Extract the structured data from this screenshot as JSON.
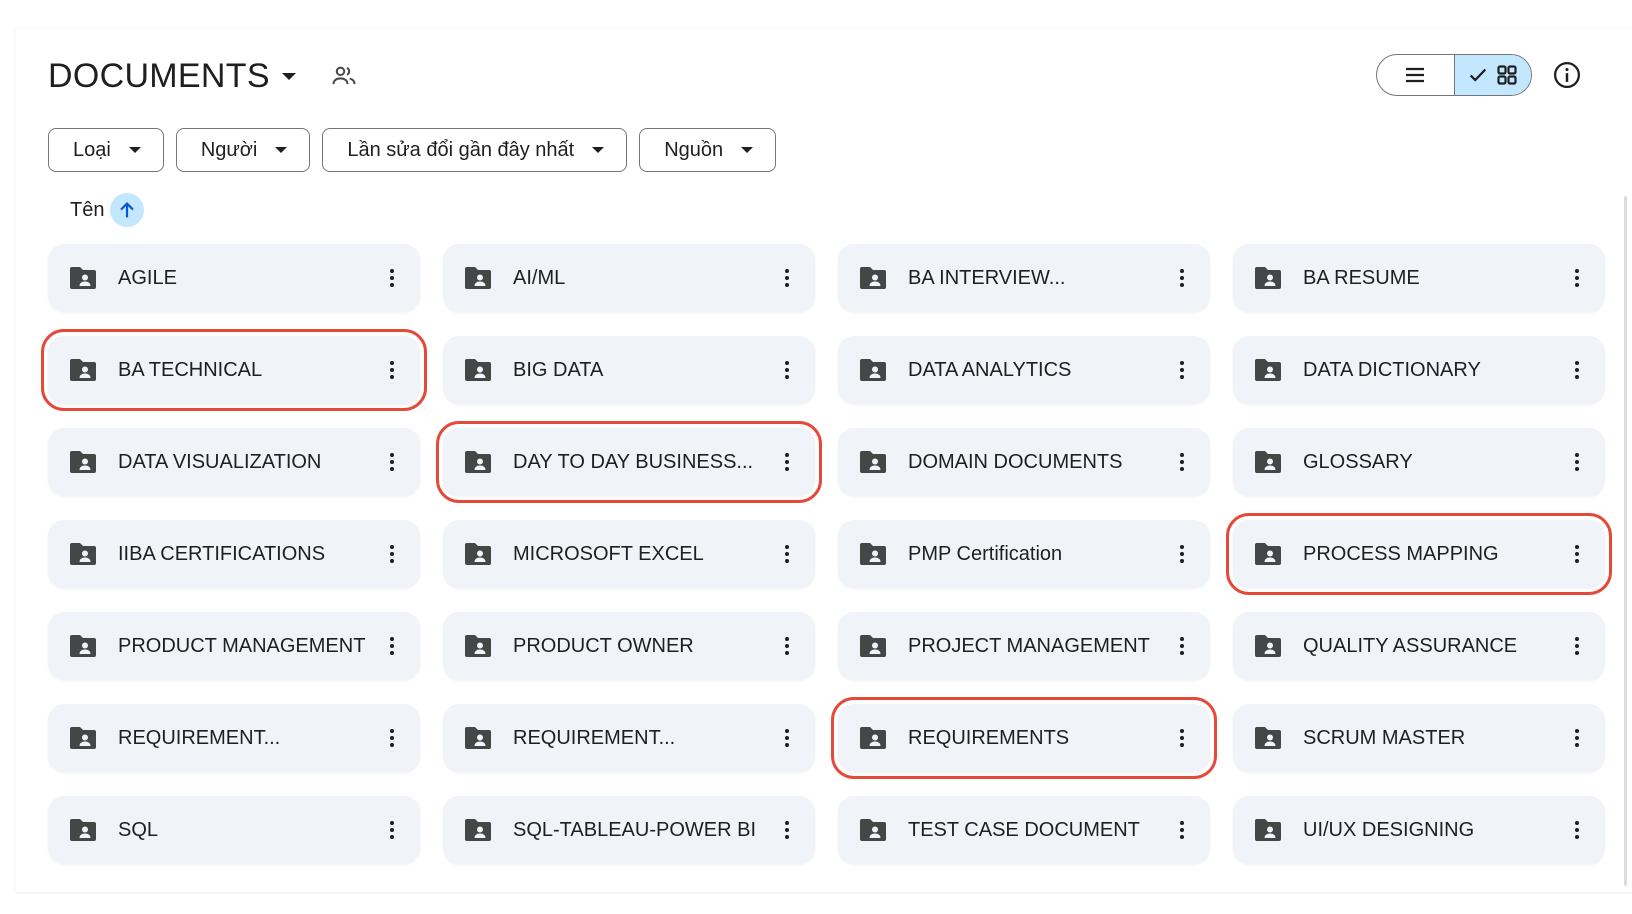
{
  "header": {
    "title": "DOCUMENTS",
    "title_dropdown_icon": "caret-down-icon",
    "shared_icon": "people-icon"
  },
  "view_toggle": {
    "list_icon": "list-view-icon",
    "grid_icon": "grid-view-icon",
    "selected": "grid",
    "selected_color": "#c2e7ff"
  },
  "info_icon": "info-icon",
  "filters": [
    {
      "label": "Loại"
    },
    {
      "label": "Người"
    },
    {
      "label": "Lần sửa đổi gần đây nhất"
    },
    {
      "label": "Nguồn"
    }
  ],
  "sort": {
    "label": "Tên",
    "direction": "ascending",
    "icon": "arrow-up-icon"
  },
  "highlight_color": "#e5493a",
  "folders": [
    {
      "name": "AGILE",
      "highlighted": false
    },
    {
      "name": "AI/ML",
      "highlighted": false
    },
    {
      "name": "BA INTERVIEW...",
      "highlighted": false
    },
    {
      "name": "BA RESUME",
      "highlighted": false
    },
    {
      "name": "BA TECHNICAL",
      "highlighted": true
    },
    {
      "name": "BIG DATA",
      "highlighted": false
    },
    {
      "name": "DATA ANALYTICS",
      "highlighted": false
    },
    {
      "name": "DATA DICTIONARY",
      "highlighted": false
    },
    {
      "name": "DATA VISUALIZATION",
      "highlighted": false
    },
    {
      "name": "DAY TO DAY BUSINESS...",
      "highlighted": true
    },
    {
      "name": "DOMAIN DOCUMENTS",
      "highlighted": false
    },
    {
      "name": "GLOSSARY",
      "highlighted": false
    },
    {
      "name": "IIBA CERTIFICATIONS",
      "highlighted": false
    },
    {
      "name": "MICROSOFT EXCEL",
      "highlighted": false
    },
    {
      "name": "PMP Certification",
      "highlighted": false
    },
    {
      "name": "PROCESS MAPPING",
      "highlighted": true
    },
    {
      "name": "PRODUCT MANAGEMENT",
      "highlighted": false
    },
    {
      "name": "PRODUCT OWNER",
      "highlighted": false
    },
    {
      "name": "PROJECT MANAGEMENT",
      "highlighted": false
    },
    {
      "name": "QUALITY ASSURANCE",
      "highlighted": false
    },
    {
      "name": "REQUIREMENT...",
      "highlighted": false
    },
    {
      "name": "REQUIREMENT...",
      "highlighted": false
    },
    {
      "name": "REQUIREMENTS",
      "highlighted": true
    },
    {
      "name": "SCRUM MASTER",
      "highlighted": false
    },
    {
      "name": "SQL",
      "highlighted": false
    },
    {
      "name": "SQL-TABLEAU-POWER BI",
      "highlighted": false
    },
    {
      "name": "TEST CASE DOCUMENT",
      "highlighted": false
    },
    {
      "name": "UI/UX DESIGNING",
      "highlighted": false
    }
  ]
}
